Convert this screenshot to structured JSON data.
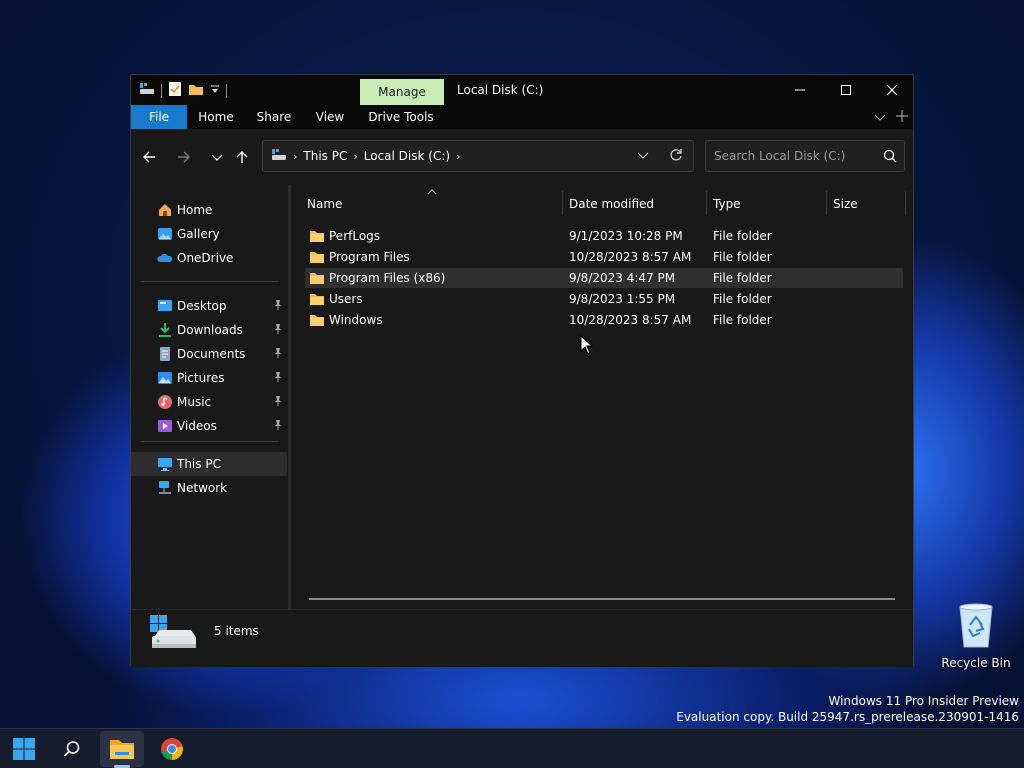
{
  "window": {
    "title": "Local Disk (C:)",
    "contextual_tab": "Manage",
    "ribbon_tabs": [
      "File",
      "Home",
      "Share",
      "View",
      "Drive Tools"
    ],
    "accent_color": "#1979ca"
  },
  "address_bar": {
    "breadcrumbs": [
      "This PC",
      "Local Disk (C:)"
    ],
    "search_placeholder": "Search Local Disk (C:)"
  },
  "nav_pane": {
    "top": [
      {
        "label": "Home",
        "icon": "home-icon"
      },
      {
        "label": "Gallery",
        "icon": "gallery-icon"
      },
      {
        "label": "OneDrive",
        "icon": "onedrive-icon"
      }
    ],
    "pinned": [
      {
        "label": "Desktop",
        "icon": "desktop-icon"
      },
      {
        "label": "Downloads",
        "icon": "downloads-icon"
      },
      {
        "label": "Documents",
        "icon": "documents-icon"
      },
      {
        "label": "Pictures",
        "icon": "pictures-icon"
      },
      {
        "label": "Music",
        "icon": "music-icon"
      },
      {
        "label": "Videos",
        "icon": "videos-icon"
      }
    ],
    "bottom": [
      {
        "label": "This PC",
        "icon": "this-pc-icon",
        "selected": true
      },
      {
        "label": "Network",
        "icon": "network-icon"
      }
    ]
  },
  "file_list": {
    "columns": [
      "Name",
      "Date modified",
      "Type",
      "Size"
    ],
    "rows": [
      {
        "name": "PerfLogs",
        "date": "9/1/2023 10:28 PM",
        "type": "File folder"
      },
      {
        "name": "Program Files",
        "date": "10/28/2023 8:57 AM",
        "type": "File folder"
      },
      {
        "name": "Program Files (x86)",
        "date": "9/8/2023 4:47 PM",
        "type": "File folder",
        "hover": true
      },
      {
        "name": "Users",
        "date": "9/8/2023 1:55 PM",
        "type": "File folder"
      },
      {
        "name": "Windows",
        "date": "10/28/2023 8:57 AM",
        "type": "File folder"
      }
    ]
  },
  "status": {
    "item_count": "5 items"
  },
  "desktop": {
    "recycle_bin_label": "Recycle Bin",
    "watermark_line1": "Windows 11 Pro Insider Preview",
    "watermark_line2": "Evaluation copy. Build 25947.rs_prerelease.230901-1416"
  },
  "taskbar": {
    "items": [
      "start-icon",
      "search-icon",
      "file-explorer-icon",
      "chrome-icon"
    ],
    "active": "file-explorer-icon"
  }
}
